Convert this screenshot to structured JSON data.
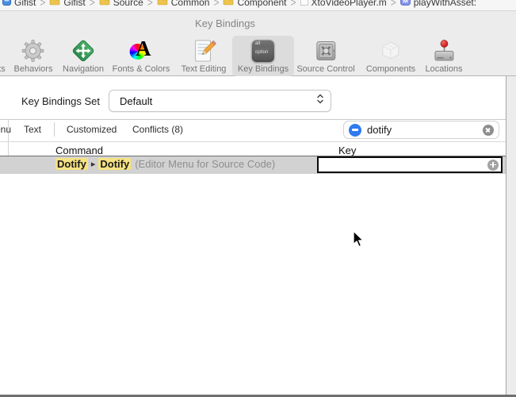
{
  "breadcrumb": {
    "separator": ">",
    "items": [
      {
        "icon": "project-icon",
        "label": "Gifist"
      },
      {
        "icon": "folder-icon",
        "label": "Gifist"
      },
      {
        "icon": "folder-icon",
        "label": "Source"
      },
      {
        "icon": "folder-icon",
        "label": "Common"
      },
      {
        "icon": "folder-icon",
        "label": "Component"
      },
      {
        "icon": "file-icon",
        "label": "XtoVideoPlayer.m"
      },
      {
        "icon": "method-icon",
        "label": "playWithAsset:"
      }
    ]
  },
  "window": {
    "title": "Key Bindings",
    "toolbar": [
      {
        "icon": "accounts-icon",
        "label": "Accounts",
        "selected": false
      },
      {
        "icon": "gear-icon",
        "label": "Behaviors",
        "selected": false
      },
      {
        "icon": "navigation-diamond-icon",
        "label": "Navigation",
        "selected": false
      },
      {
        "icon": "fonts-colors-icon",
        "label": "Fonts & Colors",
        "selected": false
      },
      {
        "icon": "text-editing-icon",
        "label": "Text Editing",
        "selected": false
      },
      {
        "icon": "option-key-icon",
        "label": "Key Bindings",
        "selected": true
      },
      {
        "icon": "safe-icon",
        "label": "Source Control",
        "selected": false
      },
      {
        "icon": "components-box-icon",
        "label": "Components",
        "selected": false
      },
      {
        "icon": "hard-drive-pin-icon",
        "label": "Locations",
        "selected": false
      }
    ]
  },
  "key_bindings_set": {
    "label": "Key Bindings Set",
    "value": "Default"
  },
  "scope_bar": {
    "items": [
      "Menu",
      "Text",
      "Customized",
      "Conflicts (8)"
    ]
  },
  "search": {
    "value": "dotify"
  },
  "table": {
    "columns": [
      "Command",
      "Key"
    ],
    "row": {
      "command_first": "Dotify",
      "command_arrow": "▸",
      "command_second": "Dotify",
      "command_context": "(Editor Menu for Source Code)",
      "key_value": ""
    }
  },
  "colors": {
    "accent_blue": "#2e7bf0",
    "match_highlight": "#f6e283",
    "row_selection": "#d2d2d2"
  }
}
